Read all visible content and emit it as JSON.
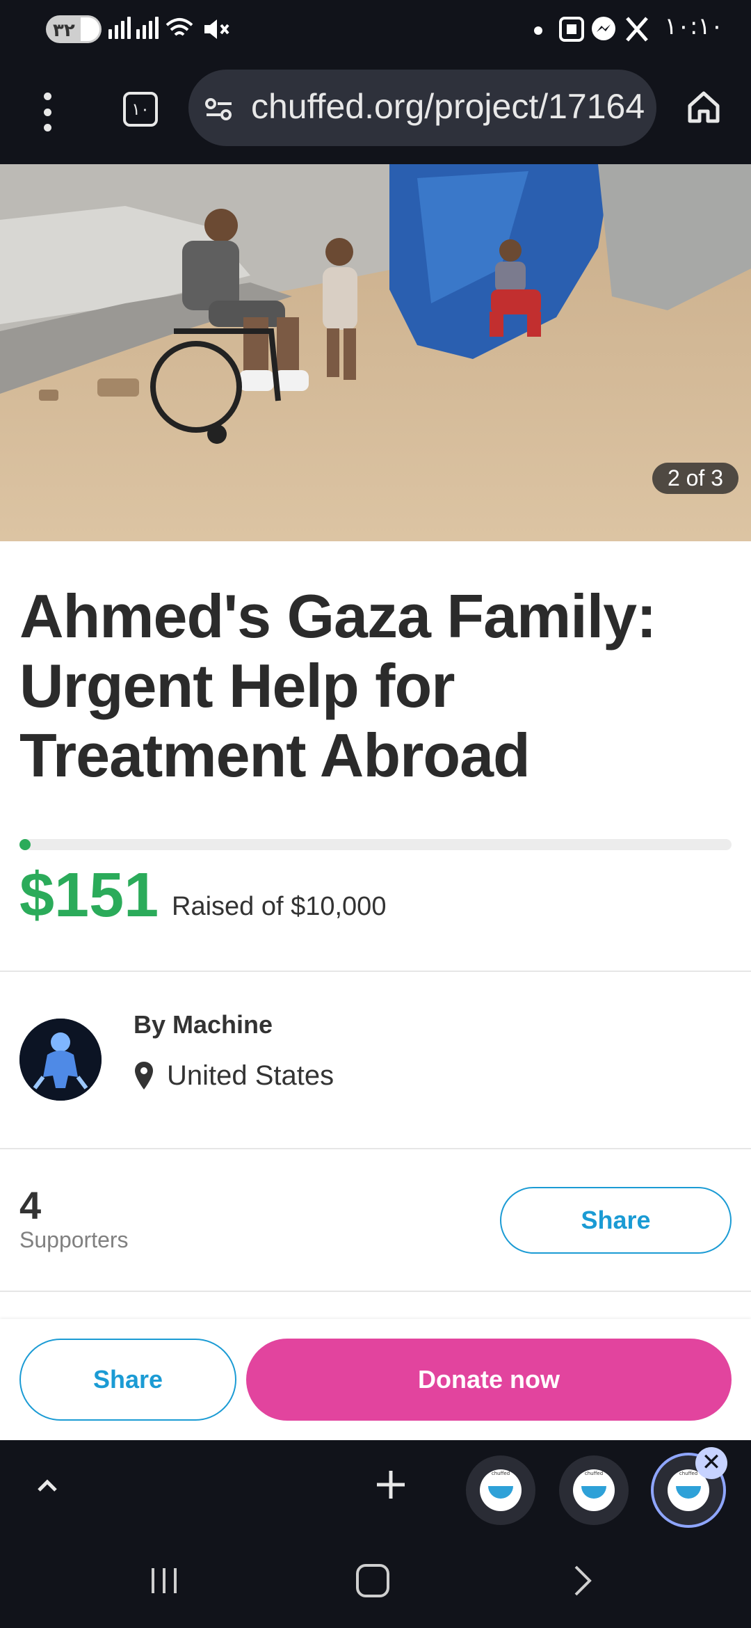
{
  "status_bar": {
    "battery": "٣٢",
    "time": "١٠:١٠"
  },
  "browser": {
    "tabs_count": "١٠",
    "url": "chuffed.org/project/17164"
  },
  "hero": {
    "image_counter": "2 of 3"
  },
  "campaign": {
    "title": "Ahmed's Gaza Family: Urgent Help for Treatment Abroad",
    "raised_amount": "$151",
    "raised_text": "Raised of $10,000",
    "progress_fraction": 0.0151,
    "accent_color": "#2bab5a"
  },
  "organizer": {
    "by": "By Machine",
    "location": "United States"
  },
  "supporters": {
    "count": "4",
    "label": "Supporters",
    "share_label": "Share"
  },
  "actions": {
    "share_label": "Share",
    "donate_label": "Donate now",
    "donate_color": "#e2449e"
  },
  "browser_bottom": {
    "tab_thumb_caption": "chuffed",
    "close_glyph": "✕"
  }
}
